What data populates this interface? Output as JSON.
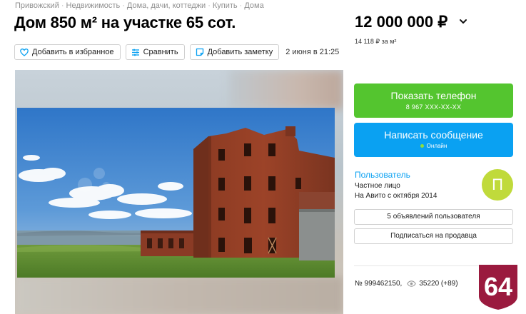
{
  "breadcrumb": [
    "Привожский",
    "Недвижимость",
    "Дома, дачи, коттеджи",
    "Купить",
    "Дома"
  ],
  "breadcrumb_separator": "·",
  "title": "Дом 850 м² на участке 65 сот.",
  "price": {
    "value": "12 000 000 ₽",
    "per_m2": "14 118 ₽ за м²"
  },
  "actions": {
    "favorite": "Добавить в избранное",
    "compare": "Сравнить",
    "note": "Добавить заметку",
    "date": "2 июня в 21:25"
  },
  "gallery": {
    "photo_subject": "red brick building by the lake"
  },
  "contact": {
    "show_phone": "Показать телефон",
    "phone_masked": "8 967 XXX-XX-XX",
    "write_message": "Написать сообщение",
    "online": "Онлайн"
  },
  "seller": {
    "name": "Пользователь",
    "type": "Частное лицо",
    "since": "На Авито с октября 2014",
    "avatar_letter": "П",
    "avatar_color": "#c0da3b"
  },
  "seller_buttons": {
    "listings": "5 объявлений пользователя",
    "subscribe": "Подписаться на продавца"
  },
  "listing_meta": {
    "number": "№ 999462150,",
    "views": "35220 (+89)"
  },
  "badge": {
    "text": "64",
    "color": "#9a1a3e"
  },
  "colors": {
    "green": "#54c52f",
    "blue": "#0aa1f2"
  },
  "icons": [
    "heart-icon",
    "compare-icon",
    "note-icon",
    "chevron-down-icon",
    "eye-icon"
  ]
}
